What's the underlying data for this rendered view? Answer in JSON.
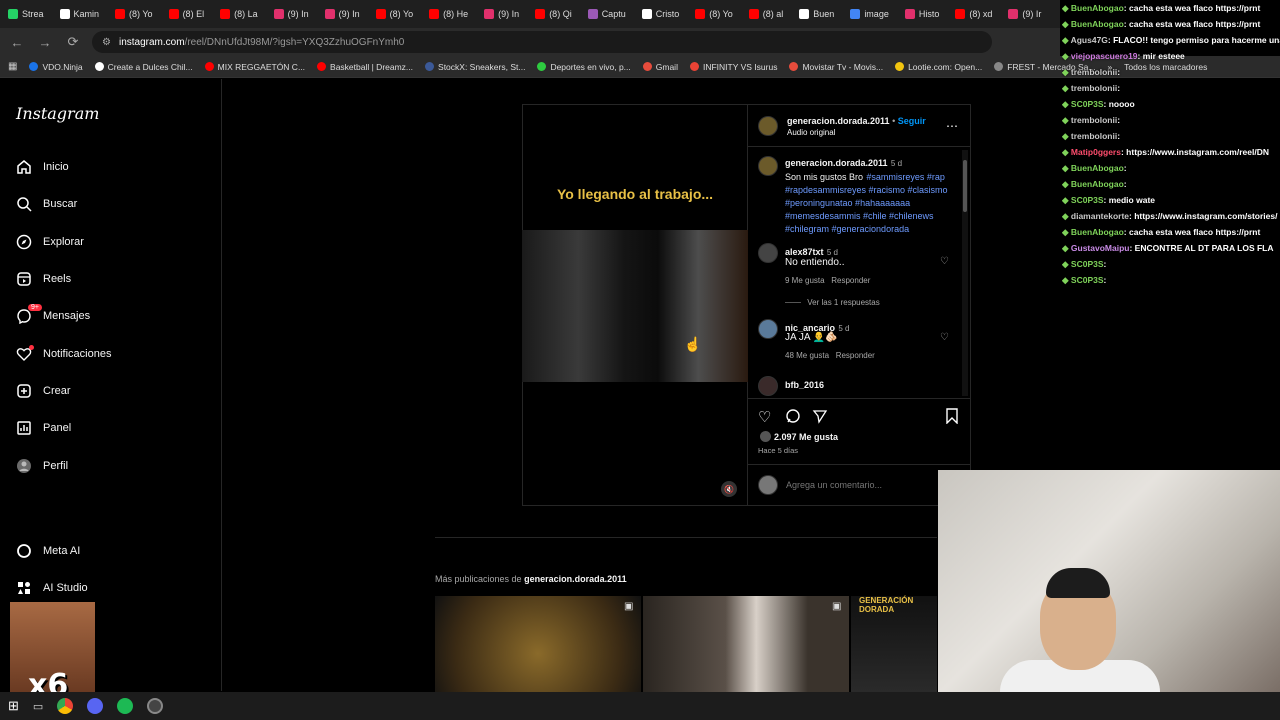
{
  "browser": {
    "tabs": [
      "Strea",
      "Kamin",
      "(8) Yo",
      "(8) El",
      "(8) La",
      "(9) In",
      "(9) In",
      "(8) Yo",
      "(8) He",
      "(9) In",
      "(8) Qi",
      "Captu",
      "Cristo",
      "(8) Yo",
      "(8) al",
      "Buen",
      "image",
      "Histo",
      "(8) xd",
      "(9) Ir"
    ],
    "url_host": "instagram.com",
    "url_rest": "/reel/DNnUfdJt98M/?igsh=YXQ3ZzhuOGFnYmh0",
    "bookmarks": [
      "VDO.Ninja",
      "Create a Dulces Chil...",
      "MIX REGGAETÓN C...",
      "Basketball | Dreamz...",
      "StockX: Sneakers, St...",
      "Deportes en vivo, p...",
      "Gmail",
      "INFINITY VS Isurus",
      "Movistar Tv - Movis...",
      "Lootie.com: Open...",
      "FREST - Mercado Sa..."
    ],
    "all_bookmarks": "Todos los marcadores",
    "more_bookmarks": "»"
  },
  "sidebar": {
    "logo": "Instagram",
    "items": [
      {
        "label": "Inicio",
        "icon": "home-icon"
      },
      {
        "label": "Buscar",
        "icon": "search-icon"
      },
      {
        "label": "Explorar",
        "icon": "compass-icon"
      },
      {
        "label": "Reels",
        "icon": "reels-icon"
      },
      {
        "label": "Mensajes",
        "icon": "messenger-icon"
      },
      {
        "label": "Notificaciones",
        "icon": "heart-icon"
      },
      {
        "label": "Crear",
        "icon": "plus-square-icon"
      },
      {
        "label": "Panel",
        "icon": "chart-icon"
      },
      {
        "label": "Perfil",
        "icon": "profile-avatar"
      }
    ],
    "badge": "9+",
    "meta_ai": "Meta AI",
    "ai_studio": "AI Studio"
  },
  "reel": {
    "overlay_text": "Yo llegando al trabajo...",
    "mute_icon": "speaker-muted-icon"
  },
  "post": {
    "author": "generacion.dorada.2011",
    "follow": "Seguir",
    "audio": "Audio original",
    "caption_author": "generacion.dorada.2011",
    "caption_time": "5 d",
    "caption_text": "Son mis gustos Bro",
    "caption_tags": "#sammisreyes #rap #rapdesammisreyes #racismo #clasismo #peroningunatao #hahaaaaaaa #memesdesammis #chile #chilenews #chilegram #generaciondorada",
    "comments": [
      {
        "user": "alex87txt",
        "time": "5 d",
        "text": "No entiendo..",
        "likes": "9 Me gusta",
        "reply": "Responder",
        "view_replies": "Ver las 1 respuestas"
      },
      {
        "user": "nic_ancario",
        "time": "5 d",
        "text": "JA JA 👨‍🦲🫵🏻",
        "likes": "48 Me gusta",
        "reply": "Responder"
      },
      {
        "user": "bfb_2016"
      }
    ],
    "likes": "2.097 Me gusta",
    "age": "Hace 5 días",
    "comment_placeholder": "Agrega un comentario..."
  },
  "more_posts": {
    "prefix": "Más publicaciones de",
    "author": "generacion.dorada.2011",
    "third_thumb_text": "GENERACIÓN DORADA"
  },
  "chat": [
    {
      "user": "BuenAbogao",
      "color": "#7fd35a",
      "msg": ": cacha esta wea flaco https://prnt"
    },
    {
      "user": "BuenAbogao",
      "color": "#7fd35a",
      "msg": ": cacha esta wea flaco https://prnt"
    },
    {
      "user": "Agus47G",
      "color": "#c9c9c9",
      "msg": ": FLACO!! tengo permiso para hacerme una"
    },
    {
      "user": "viejopascuero19",
      "color": "#d07be0",
      "msg": ": mir esteee"
    },
    {
      "user": "trembolonii",
      "color": "#c9c9c9",
      "msg": ":"
    },
    {
      "user": "trembolonii",
      "color": "#c9c9c9",
      "msg": ":"
    },
    {
      "user": "SC0P3S",
      "color": "#7fd35a",
      "msg": ": noooo"
    },
    {
      "user": "trembolonii",
      "color": "#c9c9c9",
      "msg": ":"
    },
    {
      "user": "trembolonii",
      "color": "#c9c9c9",
      "msg": ":"
    },
    {
      "user": "Matip0ggers",
      "color": "#ff4d6d",
      "msg": ": https://www.instagram.com/reel/DN"
    },
    {
      "user": "BuenAbogao",
      "color": "#7fd35a",
      "msg": ":"
    },
    {
      "user": "BuenAbogao",
      "color": "#7fd35a",
      "msg": ":"
    },
    {
      "user": "SC0P3S",
      "color": "#7fd35a",
      "msg": ": medio wate"
    },
    {
      "user": "diamantekorte",
      "color": "#c9c9c9",
      "msg": ": https://www.instagram.com/stories/"
    },
    {
      "user": "BuenAbogao",
      "color": "#7fd35a",
      "msg": ": cacha esta wea flaco https://prnt"
    },
    {
      "user": "GustavoMaipu",
      "color": "#c98be6",
      "msg": ": ENCONTRE AL DT PARA LOS FLA"
    },
    {
      "user": "SC0P3S",
      "color": "#7fd35a",
      "msg": ":"
    },
    {
      "user": "SC0P3S",
      "color": "#7fd35a",
      "msg": ":"
    }
  ],
  "meme_text": "x6"
}
